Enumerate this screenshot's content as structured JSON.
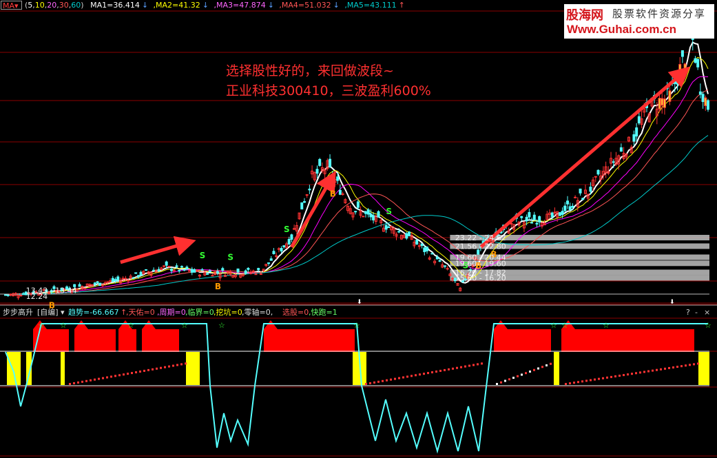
{
  "header": {
    "ma_button": "MA",
    "params_open": "(",
    "p1": "5",
    "p2": "10",
    "p3": "20",
    "p4": "30",
    "p5": "60",
    "params_close": ")",
    "ma1": "MA1=36.414",
    "ma1_arrow": "↓",
    "ma2": ",MA2=41.32",
    "ma2_arrow": "↓",
    "ma3": ",MA3=47.874",
    "ma3_arrow": "↓",
    "ma4": ",MA4=51.032",
    "ma4_arrow": "↓",
    "ma5": ",MA5=43.111",
    "ma5_arrow": "↑"
  },
  "logo": {
    "brand": "股海网",
    "tagline": "股票软件资源分享",
    "url": "Www.Guhai.com.cn"
  },
  "annotation": {
    "line1": "选择股性好的，来回做波段~",
    "line2": "正业科技300410，三波盈利600%"
  },
  "indicator_header": {
    "name": "步步高升",
    "mode": "[自编]",
    "trend": "趋势=-66.667",
    "trend_arrow": "↑",
    "tianyou": ",天佑=0",
    "zhouqi": ",周期=0",
    "linjie": ",临界=0",
    "wakeng": ",挖坑=0",
    "lingzhou": ",零轴=0,",
    "xuangu": "选股=0",
    "kuaipao": ",快跑=1"
  },
  "window_controls": {
    "help": "?",
    "minus": "-",
    "close": "×"
  },
  "colors": {
    "up": "#ff3333",
    "down": "#54ffff",
    "ma1": "#ffffff",
    "ma2": "#ffff00",
    "ma3": "#ff00ff",
    "ma4": "#ff5555",
    "ma5": "#00cccc",
    "grid": "#8b0000",
    "annotation": "#ff3030",
    "signal_buy": "#ff9900",
    "signal_sell": "#33ff33"
  },
  "chart_data": {
    "type": "candlestick",
    "price_range": [
      12.0,
      70.0
    ],
    "ma_periods": [
      5,
      10,
      20,
      30,
      60
    ],
    "price_labels": [
      {
        "text": "12.24",
        "price": 12.24
      },
      {
        "text": "13.43 - 13.44",
        "price": 13.43
      },
      {
        "text": "15.60 - 16.20",
        "price": 15.9
      },
      {
        "text": "16.20 - 17.82",
        "price": 17.0
      },
      {
        "text": "19.60 - 19.60",
        "price": 18.8
      },
      {
        "text": "19.60 - 20.44",
        "price": 20.0
      },
      {
        "text": "21.56 - 22.80",
        "price": 22.2
      },
      {
        "text": "23.22 - 24.62",
        "price": 23.9
      }
    ],
    "signals": [
      {
        "label": "B",
        "index": 18
      },
      {
        "label": "S",
        "index": 77
      },
      {
        "label": "B",
        "index": 83
      },
      {
        "label": "S",
        "index": 88
      },
      {
        "label": "S",
        "index": 110
      },
      {
        "label": "B",
        "index": 128
      },
      {
        "label": "S",
        "index": 150
      },
      {
        "label": "S",
        "index": 180
      },
      {
        "label": "B",
        "index": 185
      },
      {
        "label": "B",
        "index": 191
      },
      {
        "label": "S",
        "index": 268
      }
    ]
  }
}
